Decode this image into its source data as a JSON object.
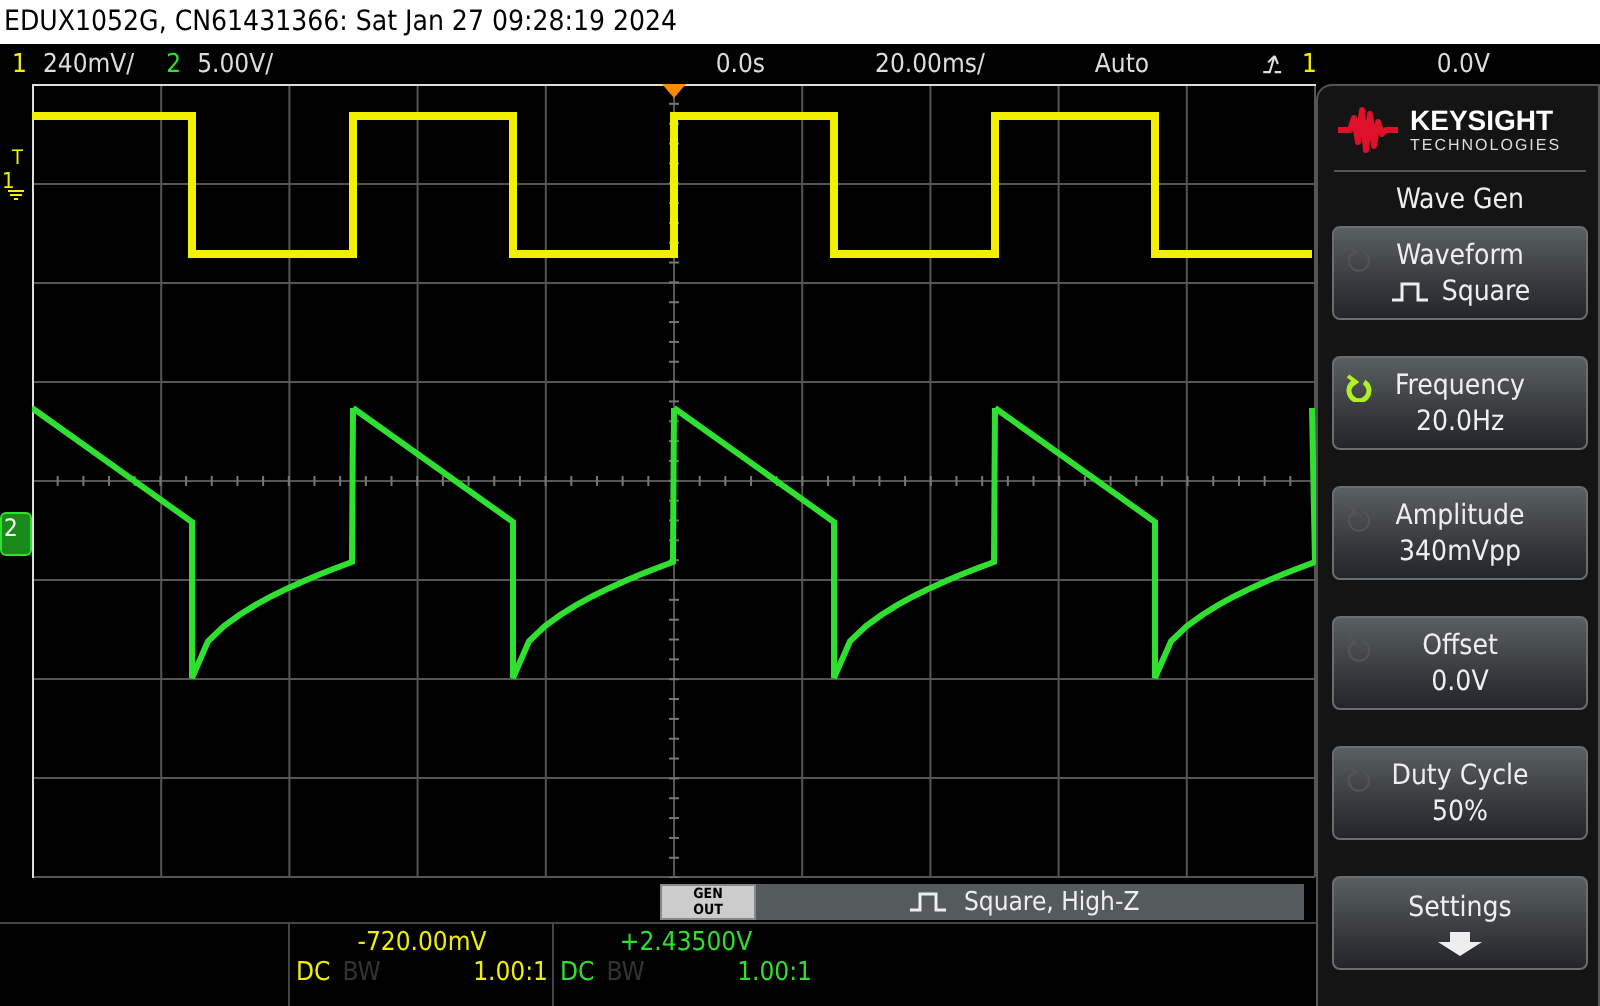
{
  "header": {
    "title": "EDUX1052G, CN61431366: Sat Jan 27 09:28:19 2024"
  },
  "status_bar": {
    "channels": [
      {
        "number": "1",
        "scale": "240mV/",
        "color": "#f0f000"
      },
      {
        "number": "2",
        "scale": "5.00V/",
        "color": "#30e030"
      }
    ],
    "time_delay": "0.0s",
    "time_scale": "20.00ms/",
    "trigger_mode": "Auto",
    "trigger_source": "1",
    "trigger_level": "0.0V"
  },
  "screen_markers": {
    "trigger_label": "T",
    "channel_1": "1",
    "channel_2": "2"
  },
  "gen_out": {
    "label": "GEN OUT",
    "waveform_icon": true,
    "text": "Square, High-Z"
  },
  "channel_info": [
    {
      "color": "#f0f000",
      "reading": "-720.00mV",
      "coupling": "DC",
      "bw_label": "BW",
      "bw_limit": false,
      "probe": "1.00:1"
    },
    {
      "color": "#30e030",
      "reading": "+2.43500V",
      "coupling": "DC",
      "bw_label": "BW",
      "bw_limit": false,
      "probe": "1.00:1"
    }
  ],
  "panel": {
    "brand": "KEYSIGHT",
    "brand_sub": "TECHNOLOGIES",
    "title": "Wave Gen",
    "softkeys": [
      {
        "kind": "knob",
        "label": "Waveform",
        "value": "Square",
        "waveform_icon": true,
        "active": false
      },
      {
        "kind": "knob",
        "label": "Frequency",
        "value": "20.0Hz",
        "active": true
      },
      {
        "kind": "knob",
        "label": "Amplitude",
        "value": "340mVpp",
        "active": false
      },
      {
        "kind": "knob",
        "label": "Offset",
        "value": "0.0V",
        "active": false
      },
      {
        "kind": "knob",
        "label": "Duty Cycle",
        "value": "50%",
        "active": false
      },
      {
        "kind": "menu",
        "label": "Settings"
      }
    ]
  }
}
